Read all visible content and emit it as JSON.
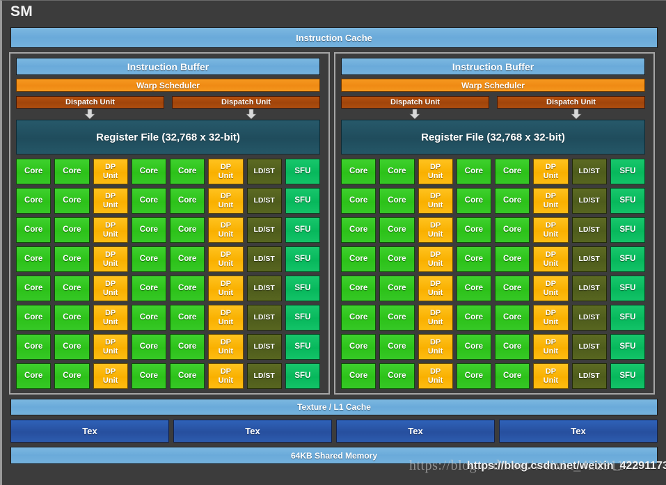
{
  "diagram": {
    "title": "SM",
    "instruction_cache": "Instruction Cache",
    "texture_l1_cache": "Texture / L1 Cache",
    "shared_memory": "64KB Shared Memory",
    "tex_units": [
      "Tex",
      "Tex",
      "Tex",
      "Tex"
    ]
  },
  "processing_blocks": [
    {
      "instruction_buffer": "Instruction Buffer",
      "warp_scheduler": "Warp Scheduler",
      "dispatch_units": [
        "Dispatch Unit",
        "Dispatch Unit"
      ],
      "register_file": "Register File (32,768 x 32-bit)"
    },
    {
      "instruction_buffer": "Instruction Buffer",
      "warp_scheduler": "Warp Scheduler",
      "dispatch_units": [
        "Dispatch Unit",
        "Dispatch Unit"
      ],
      "register_file": "Register File (32,768 x 32-bit)"
    }
  ],
  "core_grid": {
    "rows": 8,
    "columns": 8,
    "column_types": [
      "core",
      "core",
      "dp",
      "core",
      "core",
      "dp",
      "ldst",
      "sfu"
    ],
    "labels": {
      "core": "Core",
      "dp": "DP\nUnit",
      "ldst": "LD/ST",
      "sfu": "SFU"
    }
  },
  "colors": {
    "background": "#3c3c3c",
    "cache_blue": "#6aaada",
    "warp_orange": "#ef8a14",
    "dispatch_brown": "#a0450b",
    "register_teal": "#1f4c5c",
    "core_green": "#2cc219",
    "dp_amber": "#f9b000",
    "ldst_olive": "#4e5c1c",
    "sfu_green": "#07b85c",
    "tex_royal_blue": "#274f9e",
    "block_border": "#a6a6a6"
  },
  "watermarks": {
    "back": "https://blog.csdn.net/weixin_42291173",
    "front": "https://blog.csdn.net/weixin_42291173"
  }
}
